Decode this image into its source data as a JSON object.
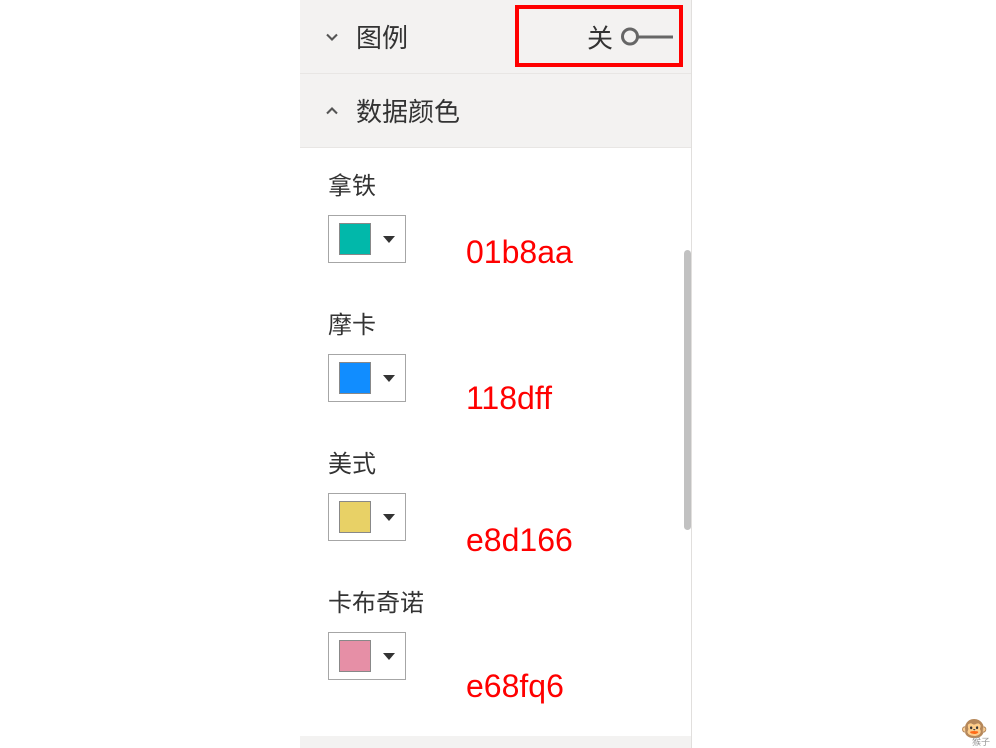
{
  "sections": {
    "legend": {
      "title": "图例",
      "toggle_label": "关",
      "toggle_state": "off"
    },
    "dataColors": {
      "title": "数据颜色"
    }
  },
  "colorItems": [
    {
      "label": "拿铁",
      "color": "#01b8aa",
      "hex_annotation": "01b8aa"
    },
    {
      "label": "摩卡",
      "color": "#118dff",
      "hex_annotation": "118dff"
    },
    {
      "label": "美式",
      "color": "#e8d166",
      "hex_annotation": "e8d166"
    },
    {
      "label": "卡布奇诺",
      "color": "#e68fa6",
      "hex_annotation": "e68fq6"
    }
  ],
  "watermark": "🐵",
  "watermark_text": "猴子"
}
